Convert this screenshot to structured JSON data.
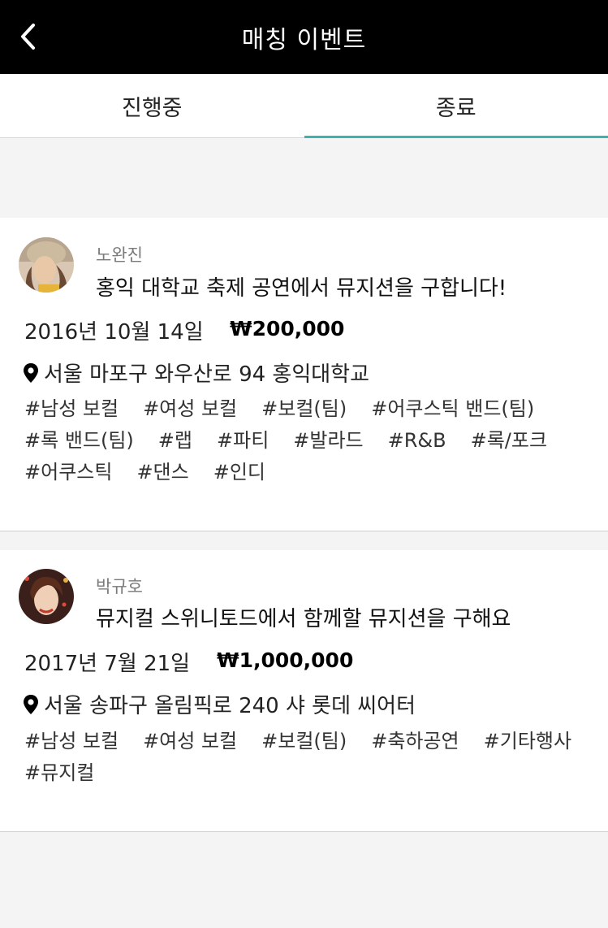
{
  "header": {
    "title": "매칭 이벤트"
  },
  "tabs": [
    {
      "label": "진행중",
      "active": false
    },
    {
      "label": "종료",
      "active": true
    }
  ],
  "accent_color": "#3bb3b3",
  "icons": {
    "back": "chevron-left-icon",
    "location": "map-pin-icon"
  },
  "events": [
    {
      "author": "노완진",
      "title": "홍익 대학교 축제 공연에서 뮤지션을 구합니다!",
      "date": "2016년 10월 14일",
      "price": "₩200,000",
      "location": "서울 마포구 와우산로 94 홍익대학교",
      "tags": [
        "#남성 보컬",
        "#여성 보컬",
        "#보컬(팀)",
        "#어쿠스틱 밴드(팀)",
        "#록 밴드(팀)",
        "#랩",
        "#파티",
        "#발라드",
        "#R&B",
        "#록/포크",
        "#어쿠스틱",
        "#댄스",
        "#인디"
      ]
    },
    {
      "author": "박규호",
      "title": "뮤지컬 스위니토드에서 함께할 뮤지션을 구해요",
      "date": "2017년 7월 21일",
      "price": "₩1,000,000",
      "location": "서울 송파구 올림픽로 240 샤 롯데 씨어터",
      "tags": [
        "#남성 보컬",
        "#여성 보컬",
        "#보컬(팀)",
        "#축하공연",
        "#기타행사",
        "#뮤지컬"
      ]
    }
  ]
}
